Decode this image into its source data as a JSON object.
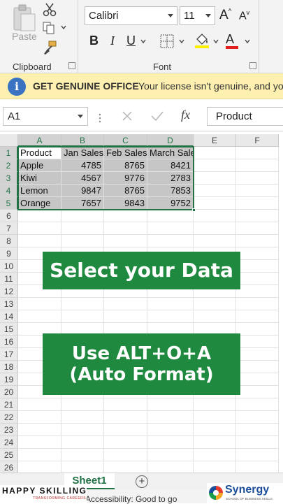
{
  "ribbon": {
    "clipboard": {
      "paste_label": "Paste",
      "group_label": "Clipboard"
    },
    "font": {
      "font_name": "Calibri",
      "font_size": "11",
      "bold": "B",
      "italic": "I",
      "underline": "U",
      "grow_font": "A",
      "shrink_font": "A",
      "font_color": "A",
      "group_label": "Font"
    }
  },
  "banner": {
    "title": "GET GENUINE OFFICE",
    "message": "Your license isn't genuine, and you"
  },
  "formula_bar": {
    "name_box": "A1",
    "fx": "fx",
    "formula": "Product"
  },
  "columns": [
    "A",
    "B",
    "C",
    "D",
    "E",
    "F"
  ],
  "rows": [
    "1",
    "2",
    "3",
    "4",
    "5",
    "6",
    "7",
    "8",
    "9",
    "10",
    "11",
    "12",
    "13",
    "14",
    "15",
    "16",
    "17",
    "18",
    "19",
    "20",
    "21",
    "22",
    "23",
    "24",
    "25",
    "26"
  ],
  "table": {
    "headers": [
      "Product",
      "Jan Sales",
      "Feb Sales",
      "March Sales"
    ],
    "data": [
      [
        "Apple",
        "4785",
        "8765",
        "8421"
      ],
      [
        "Kiwi",
        "4567",
        "9776",
        "2783"
      ],
      [
        "Lemon",
        "9847",
        "8765",
        "7853"
      ],
      [
        "Orange",
        "7657",
        "9843",
        "9752"
      ]
    ]
  },
  "overlays": {
    "box1": "Select your Data",
    "box2_line1": "Use ALT+O+A",
    "box2_line2": "(Auto Format)"
  },
  "sheet_tab": "Sheet1",
  "status": "Accessibility: Good to go",
  "branding": {
    "left_name": "HAPPY SKILLING",
    "left_tagline": "TRANSFORMING CAREERS",
    "right_name": "Synergy",
    "right_tagline": "SCHOOL OF BUSINESS SKILLS"
  },
  "colors": {
    "excel_green": "#217346",
    "overlay_green": "#1f8a3f",
    "banner_yellow": "#fdf0b0",
    "selection_gray": "#c6c6c6"
  }
}
